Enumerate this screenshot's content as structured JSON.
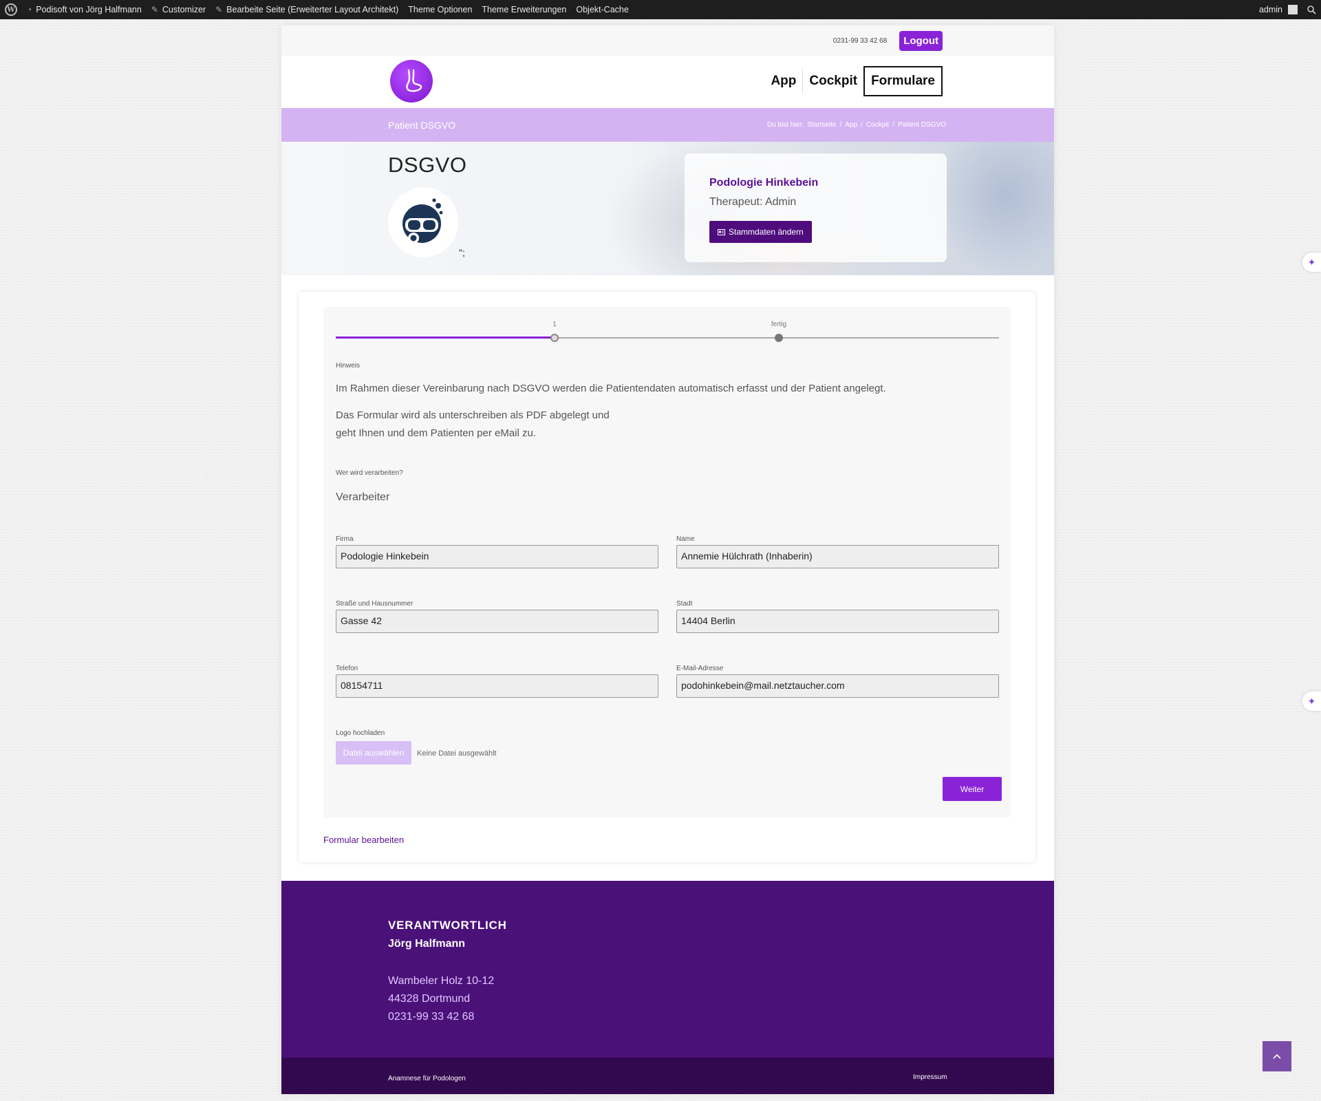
{
  "adminbar": {
    "items": [
      "Podisoft von Jörg Halfmann",
      "Customizer",
      "Bearbeite Seite (Erweiterter Layout Architekt)",
      "Theme Optionen",
      "Theme Erweiterungen",
      "Objekt-Cache"
    ],
    "user": "admin"
  },
  "topbar": {
    "phone": "0231-99 33 42 68",
    "logout": "Logout"
  },
  "nav": {
    "items": [
      "App",
      "Cockpit",
      "Formulare"
    ],
    "active": "Formulare"
  },
  "titlebar": {
    "title": "Patient DSGVO",
    "crumb_prefix": "Du bist hier:",
    "crumbs": [
      "Startseite",
      "/",
      "App",
      "/",
      "Cockpit",
      "/",
      "Patient DSGVO"
    ]
  },
  "hero": {
    "heading": "DSGVO",
    "stray_text": "\";",
    "card": {
      "practice": "Podologie Hinkebein",
      "therapist": "Therapeut: Admin",
      "button": "Stammdaten ändern"
    }
  },
  "form": {
    "steps": [
      {
        "label": "1",
        "state": "current"
      },
      {
        "label": "fertig",
        "state": "upcoming"
      }
    ],
    "progress": 0.33,
    "hint_label": "Hinweis",
    "hint_text_1": "Im Rahmen dieser Vereinbarung nach DSGVO werden die Patientendaten automatisch erfasst und der Patient angelegt.",
    "hint_text_2a": "Das Formular wird als unterschreiben als PDF abgelegt und",
    "hint_text_2b": "geht Ihnen und dem Patienten per eMail zu.",
    "processor_label": "Wer wird verarbeiten?",
    "processor_heading": "Verarbeiter",
    "fields": {
      "firma": {
        "label": "Firma",
        "value": "Podologie Hinkebein"
      },
      "name": {
        "label": "Name",
        "value": "Annemie Hülchrath (Inhaberin)"
      },
      "strasse": {
        "label": "Straße und Hausnummer",
        "value": "Gasse 42"
      },
      "stadt": {
        "label": "Stadt",
        "value": "14404 Berlin"
      },
      "telefon": {
        "label": "Telefon",
        "value": "08154711"
      },
      "email": {
        "label": "E-Mail-Adresse",
        "value": "podohinkebein@mail.netztaucher.com"
      }
    },
    "upload_label": "Logo hochladen",
    "upload_button": "Datei auswählen",
    "upload_none": "Keine Datei ausgewählt",
    "next_button": "Weiter",
    "edit_link": "Formular bearbeiten"
  },
  "footer": {
    "heading": "VERANTWORTLICH",
    "name": "Jörg Halfmann",
    "street": "Wambeler Holz 10-12",
    "city": "44328 Dortmund",
    "phone": "0231-99 33 42 68",
    "bottom_left": "Anamnese für Podologen",
    "bottom_right": "Impressum"
  },
  "colors": {
    "accent": "#8a22d8",
    "dark_purple": "#4a1179",
    "light_purple": "#d4b3f3"
  }
}
